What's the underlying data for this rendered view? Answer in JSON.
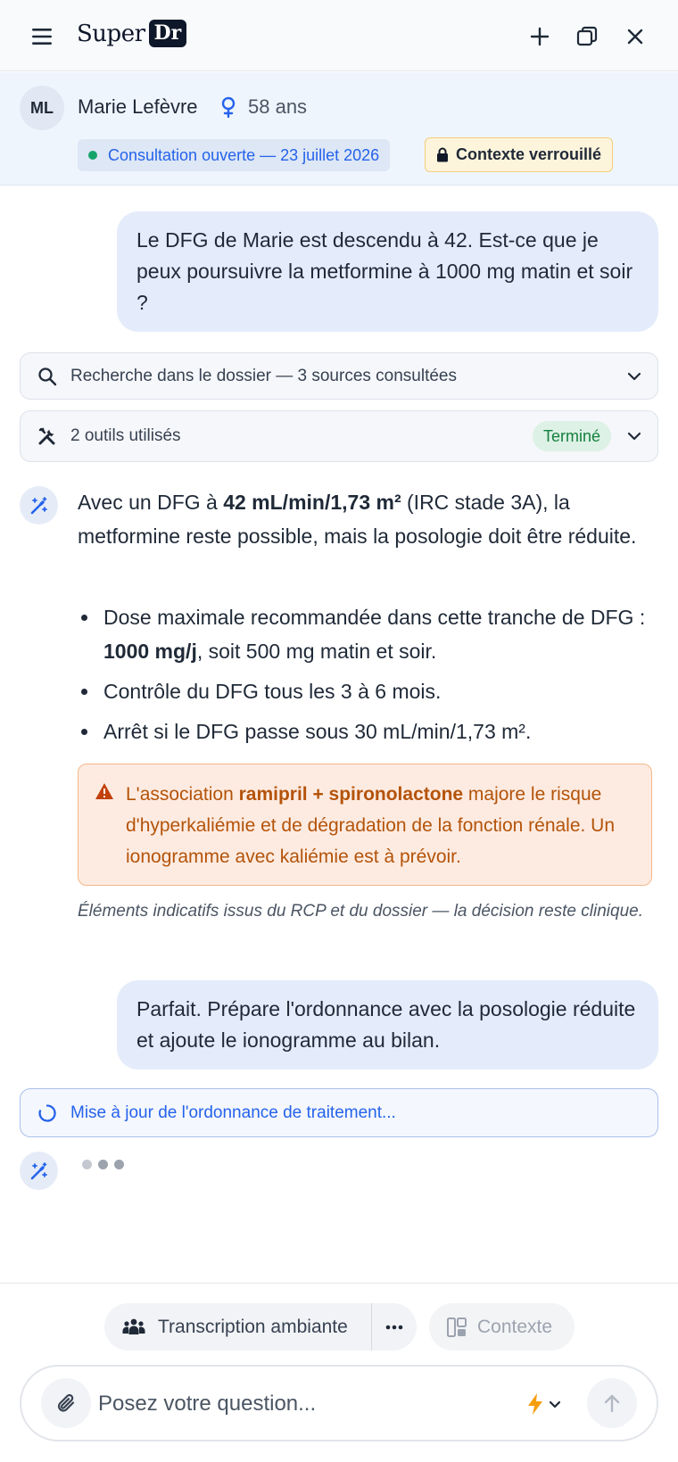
{
  "app": {
    "logo_super": "Super",
    "logo_dr": "Dr"
  },
  "header": {
    "icons": [
      "menu-icon",
      "plus-icon",
      "window-restore-icon",
      "close-icon"
    ]
  },
  "patient": {
    "initials": "ML",
    "name": "Marie Lefèvre",
    "age": "58 ans",
    "consultation": "Consultation ouverte — 23 juillet 2026",
    "context_lock": "Contexte verrouillé"
  },
  "chat": {
    "user_msg_1": "Le DFG de Marie est descendu à 42. Est-ce que je peux poursuivre la metformine à 1000 mg matin et soir ?",
    "search_step": "Recherche dans le dossier — 3 sources consultées",
    "tools_step": "2 outils utilisés",
    "tools_status": "Terminé",
    "answer": {
      "p1_a": "Avec un DFG à ",
      "p1_b": "42 mL/min/1,73 m²",
      "p1_c": " (IRC stade 3A), la metformine reste possible, mais la posologie doit être réduite.",
      "bullet1_a": "Dose maximale recommandée dans cette tranche de DFG : ",
      "bullet1_b": "1000 mg/j",
      "bullet1_c": ", soit 500 mg matin et soir.",
      "bullet2": "Contrôle du DFG tous les 3 à 6 mois.",
      "bullet3": "Arrêt si le DFG passe sous 30 mL/min/1,73 m².",
      "warning_a": "L'association ",
      "warning_b": "ramipril + spironolactone",
      "warning_c": " majore le risque d'hyperkaliémie et de dégradation de la fonction rénale. Un ionogramme avec kaliémie est à prévoir.",
      "note": "Éléments indicatifs issus du RCP et du dossier — la décision reste clinique."
    },
    "user_msg_2": "Parfait. Prépare l'ordonnance avec la posologie réduite et ajoute le ionogramme au bilan.",
    "progress_step": "Mise à jour de l'ordonnance de traitement..."
  },
  "bottom": {
    "transcription": "Transcription ambiante",
    "context": "Contexte",
    "input_placeholder": "Posez votre question..."
  },
  "colors": {
    "accent": "#2563eb",
    "success": "#15803d",
    "warning": "#b45309",
    "brand_dark": "#0f172a"
  }
}
